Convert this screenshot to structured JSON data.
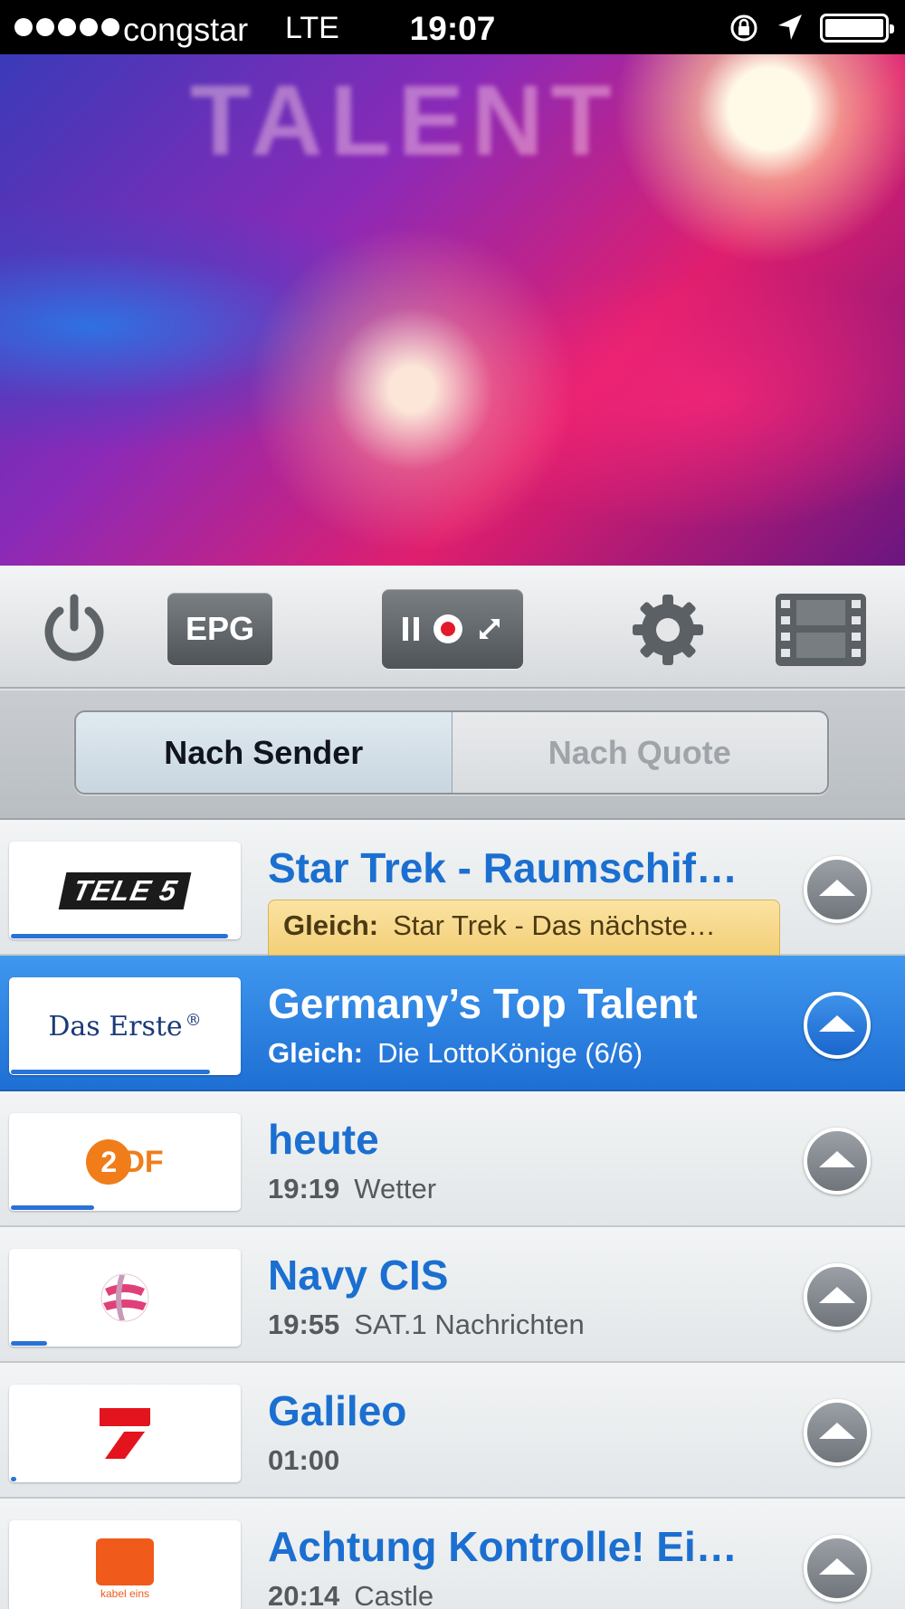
{
  "status": {
    "carrier": "congstar",
    "network": "LTE",
    "time": "19:07"
  },
  "video": {
    "overlay_text": "TALENT"
  },
  "toolbar": {
    "epg_label": "EPG"
  },
  "segmented": {
    "left": "Nach Sender",
    "right": "Nach Quote",
    "selected": "Nach Sender"
  },
  "channels": [
    {
      "logo": "TELE 5",
      "title": "Star Trek - Raumschif…",
      "label": "Gleich:",
      "subtitle": "Star Trek - Das nächste…",
      "progress": 0.94,
      "style": "badge",
      "selected": false
    },
    {
      "logo": "Das Erste",
      "title": "Germany’s Top Talent",
      "label": "Gleich:",
      "subtitle": "Die LottoKönige (6/6)",
      "progress": 0.85,
      "style": "plain",
      "selected": true
    },
    {
      "logo": "ZDF",
      "title": "heute",
      "label": "19:19",
      "subtitle": "Wetter",
      "progress": 0.34,
      "style": "plain",
      "selected": false
    },
    {
      "logo": "SAT.1",
      "title": "Navy CIS",
      "label": "19:55",
      "subtitle": "SAT.1 Nachrichten",
      "progress": 0.15,
      "style": "plain",
      "selected": false
    },
    {
      "logo": "ProSieben",
      "title": "Galileo",
      "label": "01:00",
      "subtitle": "",
      "progress": 0.02,
      "style": "plain",
      "selected": false
    },
    {
      "logo": "kabel eins",
      "title": "Achtung Kontrolle! Ei…",
      "label": "20:14",
      "subtitle": "Castle",
      "progress": 0.0,
      "style": "plain",
      "selected": false
    }
  ],
  "colors": {
    "accent_blue": "#1b6fd0",
    "selected_row": "#2a7fe0",
    "badge": "#f3cf77"
  }
}
